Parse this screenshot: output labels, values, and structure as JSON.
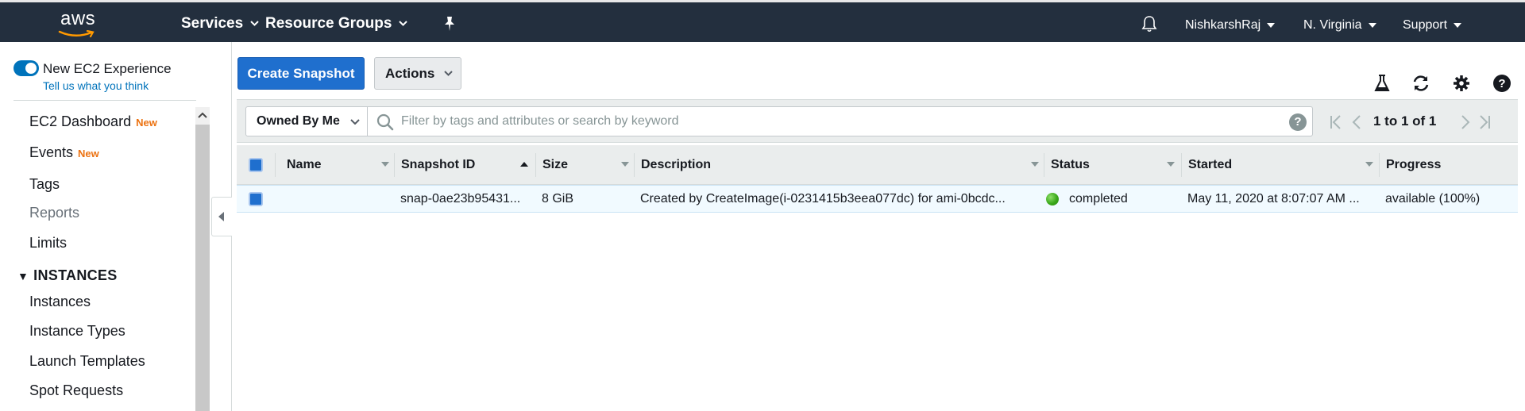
{
  "topbar": {
    "logo_text": "aws",
    "services": "Services",
    "resource_groups": "Resource Groups",
    "account": "NishkarshRaj",
    "region": "N. Virginia",
    "support": "Support"
  },
  "sidebar": {
    "experience_label": "New EC2 Experience",
    "experience_link": "Tell us what you think",
    "items": [
      {
        "label": "EC2 Dashboard",
        "badge": "New"
      },
      {
        "label": "Events",
        "badge": "New"
      },
      {
        "label": "Tags"
      },
      {
        "label": "Reports"
      },
      {
        "label": "Limits"
      }
    ],
    "section": "INSTANCES",
    "section_items": [
      "Instances",
      "Instance Types",
      "Launch Templates",
      "Spot Requests"
    ]
  },
  "toolbar": {
    "create_label": "Create Snapshot",
    "actions_label": "Actions"
  },
  "filter": {
    "owner_select": "Owned By Me",
    "search_placeholder": "Filter by tags and attributes or search by keyword",
    "help": "?",
    "pagination": "1 to 1 of 1"
  },
  "table": {
    "columns": [
      "Name",
      "Snapshot ID",
      "Size",
      "Description",
      "Status",
      "Started",
      "Progress"
    ],
    "rows": [
      {
        "name": "",
        "snapshot_id": "snap-0ae23b95431...",
        "size": "8 GiB",
        "description": "Created by CreateImage(i-0231415b3eea077dc) for ami-0bcdc...",
        "status": "completed",
        "started": "May 11, 2020 at 8:07:07 AM ...",
        "progress": "available (100%)"
      }
    ]
  },
  "colors": {
    "nav_bg": "#232f3e",
    "primary": "#1f6fce",
    "new_badge": "#ec7211",
    "link": "#0073bb",
    "status_ok": "#3aa81a"
  },
  "icons": [
    "bell-icon",
    "pin-icon",
    "flask-icon",
    "refresh-icon",
    "gear-icon",
    "help-icon",
    "search-icon"
  ]
}
